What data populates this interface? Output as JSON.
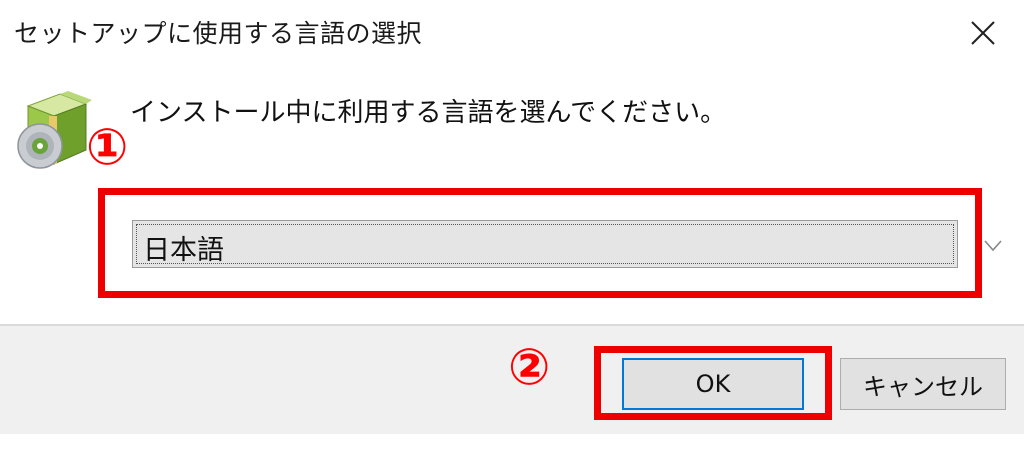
{
  "window": {
    "title": "セットアップに使用する言語の選択",
    "close_icon": "close-icon"
  },
  "content": {
    "icon": "setup-package-icon",
    "prompt": "インストール中に利用する言語を選んでください。"
  },
  "language_select": {
    "selected": "日本語",
    "arrow_icon": "chevron-down-icon"
  },
  "annotations": {
    "marker_1": "①",
    "marker_2": "②",
    "highlight_color": "#ee0000"
  },
  "buttons": {
    "ok": "OK",
    "cancel": "キャンセル"
  },
  "colors": {
    "accent_focus": "#0078d7",
    "footer_bg": "#f0f0f0"
  }
}
